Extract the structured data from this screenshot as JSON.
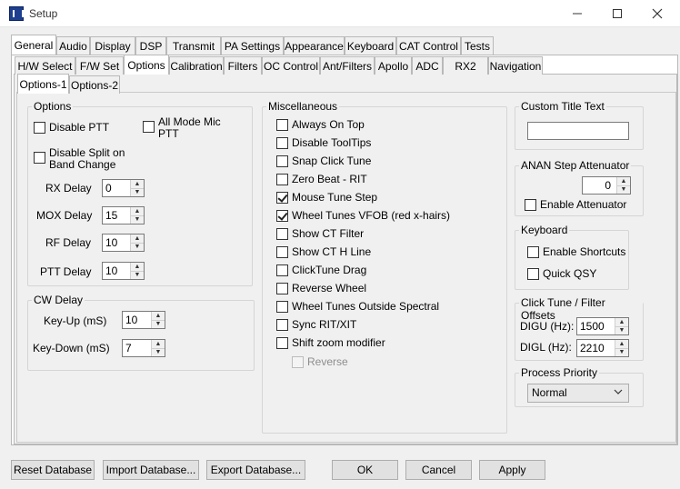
{
  "window": {
    "title": "Setup"
  },
  "tabs_main": [
    "General",
    "Audio",
    "Display",
    "DSP",
    "Transmit",
    "PA Settings",
    "Appearance",
    "Keyboard",
    "CAT Control",
    "Tests"
  ],
  "tabs_sub": [
    "H/W Select",
    "F/W Set",
    "Options",
    "Calibration",
    "Filters",
    "OC Control",
    "Ant/Filters",
    "Apollo",
    "ADC",
    "RX2",
    "Navigation"
  ],
  "tabs_opt": [
    "Options-1",
    "Options-2"
  ],
  "options": {
    "legend": "Options",
    "disable_ptt": "Disable PTT",
    "all_mode_mic_ptt": "All Mode Mic PTT",
    "disable_split": "Disable Split on Band Change",
    "rx_delay_label": "RX Delay",
    "rx_delay": "0",
    "mox_delay_label": "MOX Delay",
    "mox_delay": "15",
    "rf_delay_label": "RF Delay",
    "rf_delay": "10",
    "ptt_delay_label": "PTT Delay",
    "ptt_delay": "10"
  },
  "cw_delay": {
    "legend": "CW Delay",
    "key_up_label": "Key-Up (mS)",
    "key_up": "10",
    "key_down_label": "Key-Down (mS)",
    "key_down": "7"
  },
  "misc": {
    "legend": "Miscellaneous",
    "items": [
      {
        "label": "Always On Top",
        "checked": false
      },
      {
        "label": "Disable ToolTips",
        "checked": false
      },
      {
        "label": "Snap Click Tune",
        "checked": false
      },
      {
        "label": "Zero Beat -  RIT",
        "checked": false
      },
      {
        "label": "Mouse Tune Step",
        "checked": true
      },
      {
        "label": "Wheel Tunes VFOB (red x-hairs)",
        "checked": true
      },
      {
        "label": "Show CT Filter",
        "checked": false
      },
      {
        "label": "Show CT H Line",
        "checked": false
      },
      {
        "label": "ClickTune Drag",
        "checked": false
      },
      {
        "label": "Reverse Wheel",
        "checked": false
      },
      {
        "label": "Wheel Tunes Outside Spectral",
        "checked": false
      },
      {
        "label": "Sync RIT/XIT",
        "checked": false
      },
      {
        "label": "Shift zoom modifier",
        "checked": false
      }
    ],
    "reverse": "Reverse"
  },
  "custom_title": {
    "legend": "Custom Title Text",
    "value": ""
  },
  "anan": {
    "legend": "ANAN Step Attenuator",
    "value": "0",
    "enable": "Enable Attenuator"
  },
  "keyboard": {
    "legend": "Keyboard",
    "enable_shortcuts": "Enable Shortcuts",
    "quick_qsy": "Quick QSY"
  },
  "click_tune": {
    "legend": "Click Tune / Filter Offsets",
    "digu_label": "DIGU (Hz):",
    "digu": "1500",
    "digl_label": "DIGL (Hz):",
    "digl": "2210"
  },
  "priority": {
    "legend": "Process Priority",
    "value": "Normal"
  },
  "buttons": {
    "reset": "Reset Database",
    "import": "Import Database...",
    "export": "Export Database...",
    "ok": "OK",
    "cancel": "Cancel",
    "apply": "Apply"
  }
}
